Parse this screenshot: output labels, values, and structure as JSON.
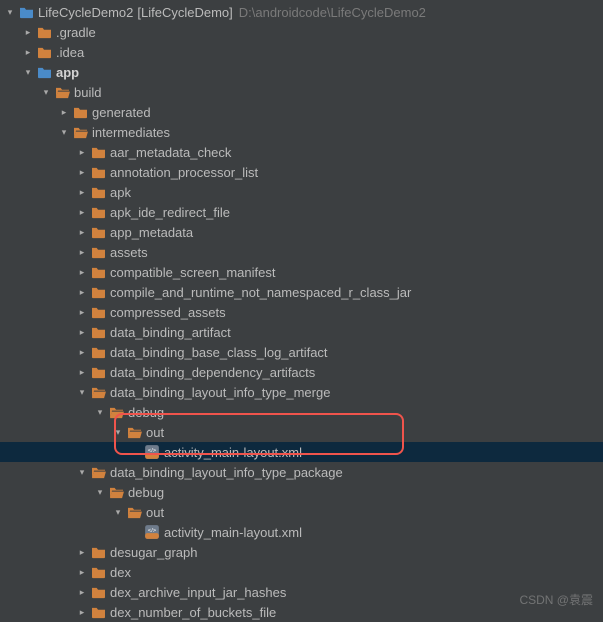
{
  "root": {
    "project": "LifeCycleDemo2",
    "bracket": "[LifeCycleDemo]",
    "path": "D:\\androidcode\\LifeCycleDemo2"
  },
  "tree": [
    {
      "d": 0,
      "chev": "down",
      "icon": "module",
      "label_bind": "root.project",
      "bracket_bind": "root.bracket",
      "path_bind": "root.path"
    },
    {
      "d": 1,
      "chev": "right",
      "icon": "folder-closed",
      "text": ".gradle"
    },
    {
      "d": 1,
      "chev": "right",
      "icon": "folder-closed",
      "text": ".idea"
    },
    {
      "d": 1,
      "chev": "down",
      "icon": "module",
      "text": "app",
      "bold": true
    },
    {
      "d": 2,
      "chev": "down",
      "icon": "folder-open",
      "text": "build"
    },
    {
      "d": 3,
      "chev": "right",
      "icon": "folder-closed",
      "text": "generated"
    },
    {
      "d": 3,
      "chev": "down",
      "icon": "folder-open",
      "text": "intermediates"
    },
    {
      "d": 4,
      "chev": "right",
      "icon": "folder-closed",
      "text": "aar_metadata_check"
    },
    {
      "d": 4,
      "chev": "right",
      "icon": "folder-closed",
      "text": "annotation_processor_list"
    },
    {
      "d": 4,
      "chev": "right",
      "icon": "folder-closed",
      "text": "apk"
    },
    {
      "d": 4,
      "chev": "right",
      "icon": "folder-closed",
      "text": "apk_ide_redirect_file"
    },
    {
      "d": 4,
      "chev": "right",
      "icon": "folder-closed",
      "text": "app_metadata"
    },
    {
      "d": 4,
      "chev": "right",
      "icon": "folder-closed",
      "text": "assets"
    },
    {
      "d": 4,
      "chev": "right",
      "icon": "folder-closed",
      "text": "compatible_screen_manifest"
    },
    {
      "d": 4,
      "chev": "right",
      "icon": "folder-closed",
      "text": "compile_and_runtime_not_namespaced_r_class_jar"
    },
    {
      "d": 4,
      "chev": "right",
      "icon": "folder-closed",
      "text": "compressed_assets"
    },
    {
      "d": 4,
      "chev": "right",
      "icon": "folder-closed",
      "text": "data_binding_artifact"
    },
    {
      "d": 4,
      "chev": "right",
      "icon": "folder-closed",
      "text": "data_binding_base_class_log_artifact"
    },
    {
      "d": 4,
      "chev": "right",
      "icon": "folder-closed",
      "text": "data_binding_dependency_artifacts"
    },
    {
      "d": 4,
      "chev": "down",
      "icon": "folder-open",
      "text": "data_binding_layout_info_type_merge"
    },
    {
      "d": 5,
      "chev": "down",
      "icon": "folder-open",
      "text": "debug"
    },
    {
      "d": 6,
      "chev": "down",
      "icon": "folder-open",
      "text": "out"
    },
    {
      "d": 7,
      "chev": "none",
      "icon": "xml-file",
      "text": "activity_main-layout.xml",
      "selected": true
    },
    {
      "d": 4,
      "chev": "down",
      "icon": "folder-open",
      "text": "data_binding_layout_info_type_package"
    },
    {
      "d": 5,
      "chev": "down",
      "icon": "folder-open",
      "text": "debug"
    },
    {
      "d": 6,
      "chev": "down",
      "icon": "folder-open",
      "text": "out"
    },
    {
      "d": 7,
      "chev": "none",
      "icon": "xml-file",
      "text": "activity_main-layout.xml"
    },
    {
      "d": 4,
      "chev": "right",
      "icon": "folder-closed",
      "text": "desugar_graph"
    },
    {
      "d": 4,
      "chev": "right",
      "icon": "folder-closed",
      "text": "dex"
    },
    {
      "d": 4,
      "chev": "right",
      "icon": "folder-closed",
      "text": "dex_archive_input_jar_hashes"
    },
    {
      "d": 4,
      "chev": "right",
      "icon": "folder-closed",
      "text": "dex_number_of_buckets_file"
    }
  ],
  "watermark": "CSDN @袁震"
}
